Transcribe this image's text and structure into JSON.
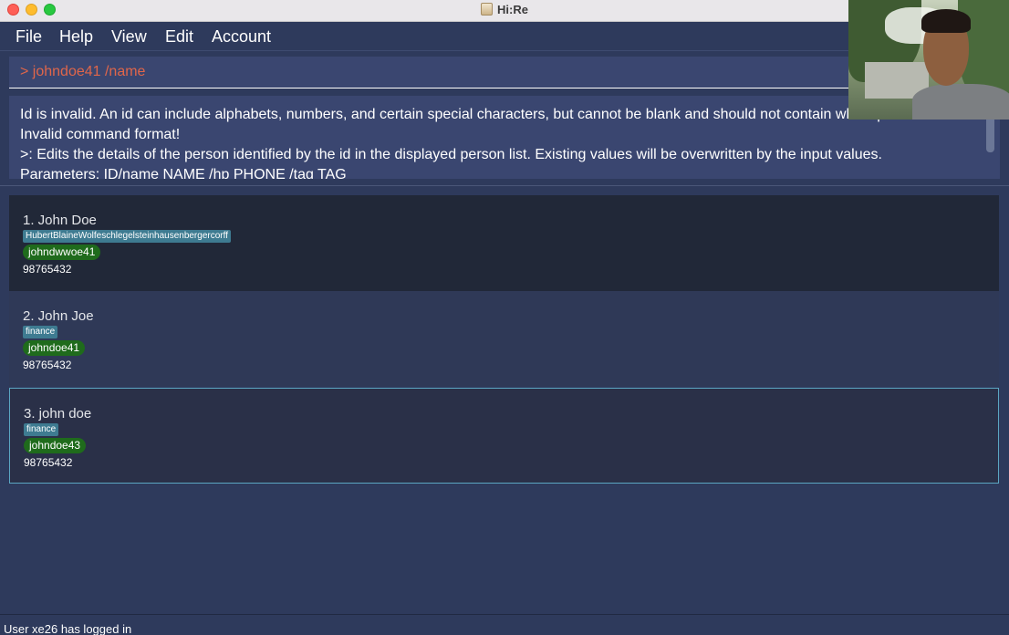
{
  "window": {
    "title": "Hi:Re"
  },
  "menu": {
    "items": [
      "File",
      "Help",
      "View",
      "Edit",
      "Account"
    ]
  },
  "command_box": {
    "value": "> johndoe41 /name"
  },
  "result_display": {
    "lines": [
      "Id is invalid. An id can include alphabets, numbers, and certain special characters, but cannot be blank and should not contain whitespace.",
      "Invalid command format!",
      ">: Edits the details of the person identified by the id in the displayed person list. Existing values will be overwritten by the input values.",
      "Parameters: ID/name NAME /hp PHONE /tag TAG"
    ]
  },
  "person_list": [
    {
      "index_name": "1.  John Doe",
      "tag": "HubertBlaineWolfeschlegelsteinhausenbergercorff",
      "username": "johndwwoe41",
      "phone": "98765432"
    },
    {
      "index_name": "2.  John Joe",
      "tag": "finance",
      "username": "johndoe41",
      "phone": "98765432"
    },
    {
      "index_name": "3.  john doe",
      "tag": "finance",
      "username": "johndoe43",
      "phone": "98765432"
    }
  ],
  "status_bar": {
    "text": "User xe26 has logged in"
  },
  "colors": {
    "background": "#2e3a5c",
    "command_text": "#e0664a",
    "tag": "#3e7b91",
    "username_pill": "#1f6b1c",
    "selected_border": "#5ba6c2"
  }
}
